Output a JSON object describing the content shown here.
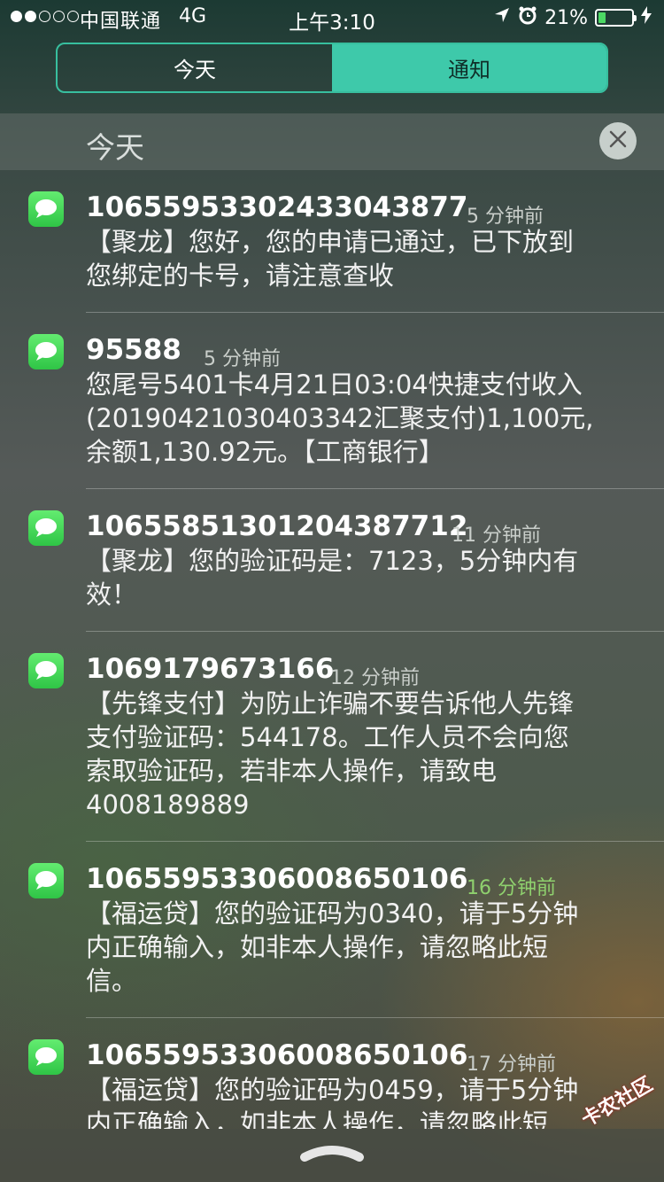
{
  "status_bar": {
    "carrier": "中国联通",
    "network": "4G",
    "time": "上午3:10",
    "battery_percent": "21%",
    "battery_level": 0.21,
    "icons": [
      "location-arrow-icon",
      "alarm-clock-icon",
      "charging-bolt-icon"
    ]
  },
  "segment": {
    "tabs": [
      {
        "label": "今天",
        "active": false
      },
      {
        "label": "通知",
        "active": true
      }
    ]
  },
  "section": {
    "title": "今天"
  },
  "notifications": [
    {
      "sender": "10655953302433043877",
      "time": "5 分钟前",
      "lines": [
        "【聚龙】您好，您的申请已通过，已下放到",
        "您绑定的卡号，请注意查收"
      ]
    },
    {
      "sender": "95588",
      "time": "5 分钟前",
      "lines": [
        "您尾号5401卡4月21日03:04快捷支付收入",
        "(20190421030403342汇聚支付)1,100元,",
        "余额1,130.92元。【工商银行】"
      ]
    },
    {
      "sender": "10655851301204387712",
      "time": "11 分钟前",
      "lines": [
        "【聚龙】您的验证码是：7123，5分钟内有",
        "效！"
      ]
    },
    {
      "sender": "1069179673166",
      "time": "12 分钟前",
      "lines": [
        "【先锋支付】为防止诈骗不要告诉他人先锋",
        "支付验证码：544178。工作人员不会向您",
        "索取验证码，若非本人操作，请致电",
        "4008189889"
      ]
    },
    {
      "sender": "10655953306008650106",
      "time": "16 分钟前",
      "lines": [
        "【福运贷】您的验证码为0340，请于5分钟",
        "内正确输入，如非本人操作，请忽略此短",
        "信。"
      ]
    },
    {
      "sender": "10655953306008650106",
      "time": "17 分钟前",
      "lines": [
        "【福运贷】您的验证码为0459，请于5分钟",
        "内正确输入，如非本人操作，请忽略此短"
      ]
    }
  ],
  "watermark": "卡农社区",
  "colors": {
    "accent": "#3ec9aa",
    "messages_green": "#34c74a",
    "battery_green": "#4cd964"
  }
}
